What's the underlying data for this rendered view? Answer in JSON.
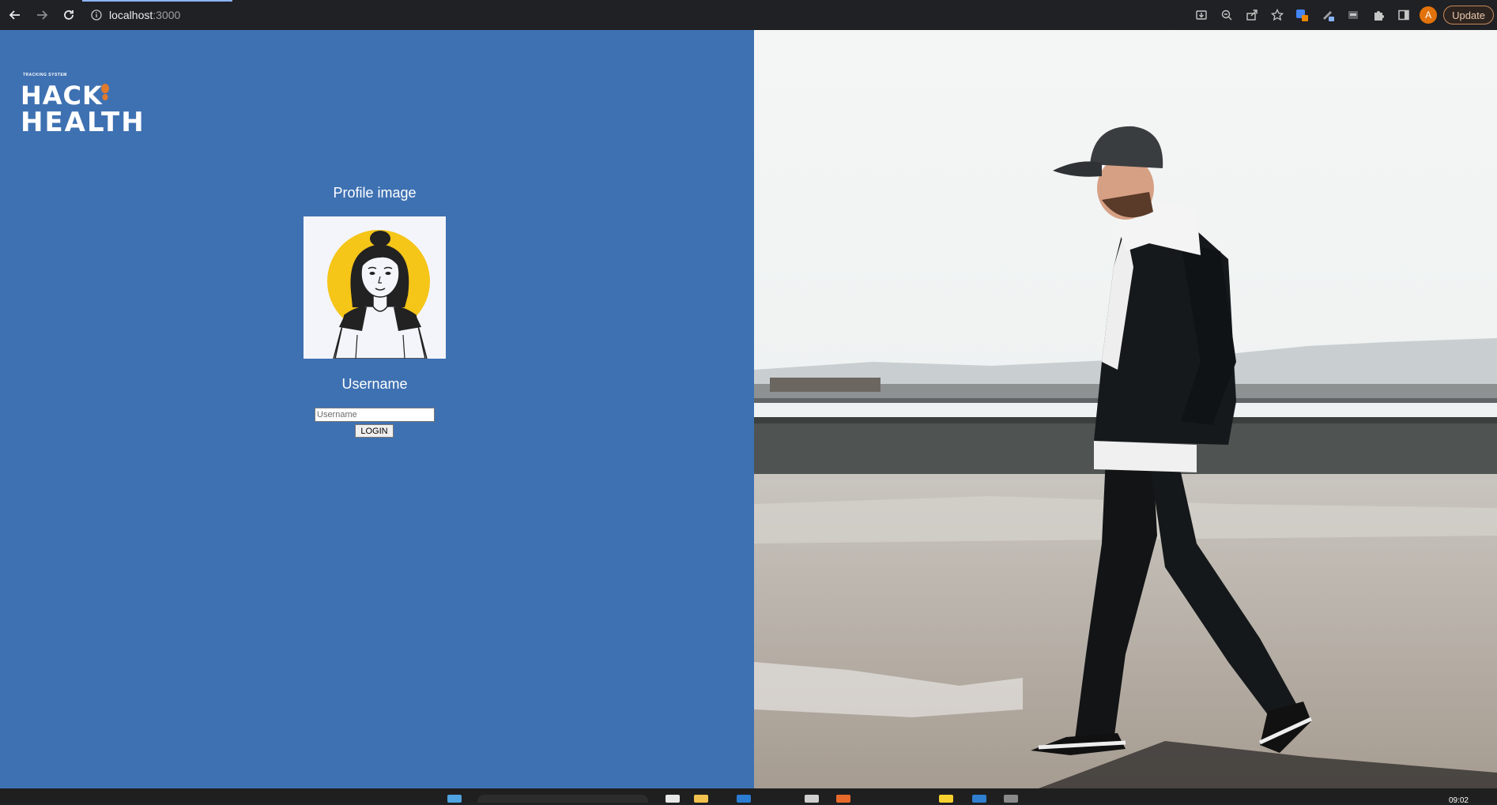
{
  "browser": {
    "url_host": "localhost",
    "url_port": ":3000",
    "update_label": "Update",
    "avatar_letter": "A"
  },
  "logo": {
    "small_text": "TRACKING SYSTEM",
    "line1": "HACK",
    "line2": "HEALTH",
    "accent_color": "#e27a2b"
  },
  "login": {
    "profile_title": "Profile image",
    "username_label": "Username",
    "username_placeholder": "Username",
    "username_value": "",
    "login_label": "LOGIN"
  },
  "colors": {
    "left_pane_bg": "#3e71b2",
    "avatar_circle": "#f5c518"
  },
  "taskbar": {
    "clock": "09:02"
  }
}
